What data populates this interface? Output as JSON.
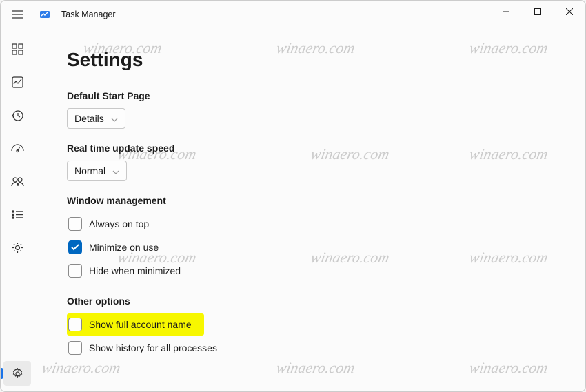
{
  "app": {
    "title": "Task Manager"
  },
  "page": {
    "title": "Settings"
  },
  "sections": {
    "startPage": {
      "label": "Default Start Page",
      "selected": "Details"
    },
    "updateSpeed": {
      "label": "Real time update speed",
      "selected": "Normal"
    },
    "windowMgmt": {
      "label": "Window management",
      "alwaysOnTop": {
        "label": "Always on top",
        "checked": false
      },
      "minimizeOnUse": {
        "label": "Minimize on use",
        "checked": true
      },
      "hideWhenMinimized": {
        "label": "Hide when minimized",
        "checked": false
      }
    },
    "other": {
      "label": "Other options",
      "showFullAccountName": {
        "label": "Show full account name",
        "checked": false,
        "highlighted": true
      },
      "showHistoryAll": {
        "label": "Show history for all processes",
        "checked": false
      }
    }
  },
  "watermark": "winaero.com",
  "sidebar": {
    "items": [
      {
        "id": "processes"
      },
      {
        "id": "performance"
      },
      {
        "id": "app-history"
      },
      {
        "id": "startup"
      },
      {
        "id": "users"
      },
      {
        "id": "details"
      },
      {
        "id": "services"
      }
    ],
    "settings": {
      "id": "settings",
      "active": true
    }
  }
}
